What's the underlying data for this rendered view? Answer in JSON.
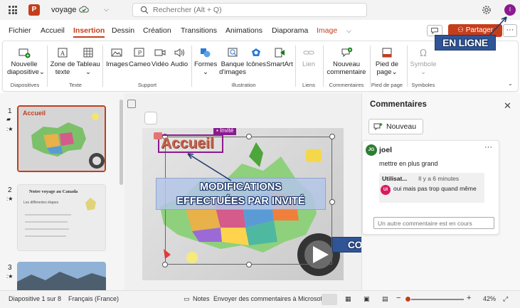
{
  "titlebar": {
    "doc_name": "voyage",
    "search_placeholder": "Rechercher (Alt + Q)",
    "avatar_initial": "I"
  },
  "tabs": [
    {
      "label": "Fichier"
    },
    {
      "label": "Accueil"
    },
    {
      "label": "Insertion"
    },
    {
      "label": "Dessin"
    },
    {
      "label": "Création"
    },
    {
      "label": "Transitions"
    },
    {
      "label": "Animations"
    },
    {
      "label": "Diaporama"
    },
    {
      "label": "Image"
    }
  ],
  "share_label": "Partager",
  "more_label": "···",
  "ribbon": {
    "diapo": {
      "new_line1": "Nouvelle",
      "new_line2": "diapositive",
      "group": "Diapositives"
    },
    "texte": {
      "zone_line1": "Zone de",
      "zone_line2": "texte",
      "table": "Tableau",
      "group": "Texte"
    },
    "support": {
      "images": "Images",
      "cameo": "Cameo",
      "video": "Vidéo",
      "audio": "Audio",
      "group": "Support"
    },
    "illustration": {
      "formes": "Formes",
      "banque_line1": "Banque",
      "banque_line2": "d'images",
      "icones": "Icônes",
      "smartart": "SmartArt",
      "group": "Illustration"
    },
    "liens": {
      "lien": "Lien",
      "group": "Liens"
    },
    "commentaires": {
      "new_line1": "Nouveau",
      "new_line2": "commentaire",
      "group": "Commentaires"
    },
    "piedpage": {
      "line1": "Pied de",
      "line2": "page",
      "group": "Pied de page"
    },
    "symboles": {
      "symbole": "Symbole",
      "group": "Symboles"
    }
  },
  "annotations": {
    "online": "EN LIGNE",
    "modif_line1": "MODIFICATIONS",
    "modif_line2": "EFFECTUÉES PAR INVITÉ",
    "comment_guest": "COMMENTAIRE INVITÉ"
  },
  "thumbnails": [
    {
      "num": "1",
      "title": "Accueil"
    },
    {
      "num": "2",
      "title": "Notre voyage au Canada",
      "subtitle": "Les différentes étapes"
    },
    {
      "num": "3"
    }
  ],
  "slide": {
    "title": "Accueil",
    "guest_tag": "Invité"
  },
  "comments": {
    "pane_title": "Commentaires",
    "new_button": "Nouveau",
    "thread": {
      "author_initials": "JG",
      "author": "joel",
      "more": "···",
      "text": "mettre en plus grand",
      "reply_author": "Utilisat...",
      "reply_time": "Il y a 6 minutes",
      "reply_initials": "UI",
      "reply_text": "oui mais pas trop quand même"
    },
    "reply_placeholder": "Un autre commentaire est en cours"
  },
  "status": {
    "slide_info": "Diapositive 1 sur 8",
    "language": "Français (France)",
    "notes": "Notes",
    "feedback": "Envoyer des commentaires à Microsoft",
    "zoom_minus": "−",
    "zoom_plus": "+",
    "zoom": "42%"
  },
  "colors": {
    "accent": "#c43e1c",
    "guest": "#8a1a8f",
    "annotation_bg": "#2f5597",
    "annotation_arrow": "#1f3a6b",
    "joel_badge": "#2e7d32"
  }
}
